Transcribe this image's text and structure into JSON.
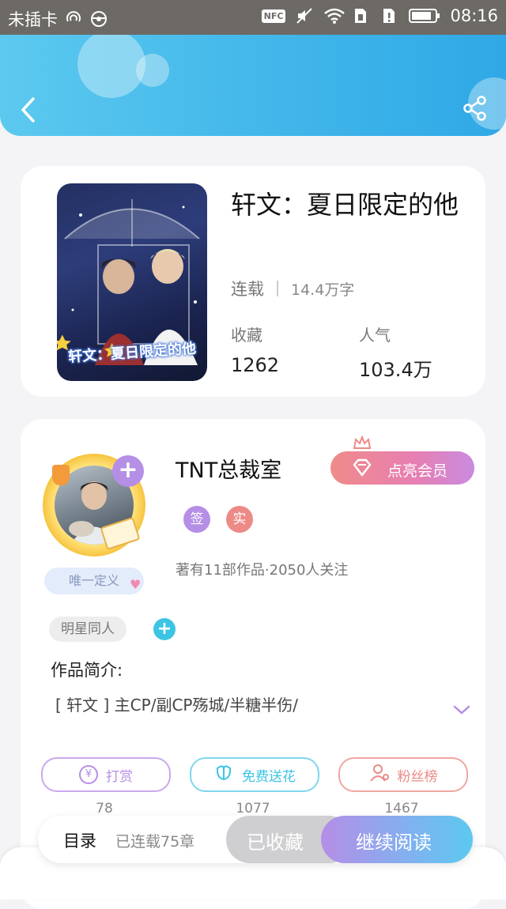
{
  "status_bar": {
    "carrier": "未插卡",
    "nfc": "NFC",
    "time": "08:16"
  },
  "book": {
    "cover_caption": "轩文：夏日限定的他",
    "title": "轩文：夏日限定的他",
    "status": "连载",
    "word_count": "14.4万字",
    "favorites_label": "收藏",
    "favorites_value": "1262",
    "popularity_label": "人气",
    "popularity_value": "103.4万"
  },
  "author": {
    "name": "TNT总裁室",
    "badge_label": "唯一定义",
    "vip_button": "点亮会员",
    "tags": [
      "签",
      "实"
    ],
    "works_info": "著有11部作品·2050人关注"
  },
  "genre_tag": "明星同人",
  "intro": {
    "label": "作品简介:",
    "text": "[ 轩文 ] 主CP/副CP殇城/半糖半伤/"
  },
  "actions": {
    "tip": {
      "label": "打赏",
      "count": "78",
      "icon_glyph": "¥"
    },
    "flower": {
      "label": "免费送花",
      "count": "1077"
    },
    "fans": {
      "label": "粉丝榜",
      "count": "1467"
    }
  },
  "bottom": {
    "toc_label": "目录",
    "chapters": "已连载75章",
    "collected_label": "已收藏",
    "continue_label": "继续阅读"
  },
  "colors": {
    "header_blue": "#43b8ea",
    "purple": "#b58ee6",
    "teal": "#3cc4e4",
    "coral": "#ec8a86",
    "vip_pink": "#e67fb3"
  }
}
